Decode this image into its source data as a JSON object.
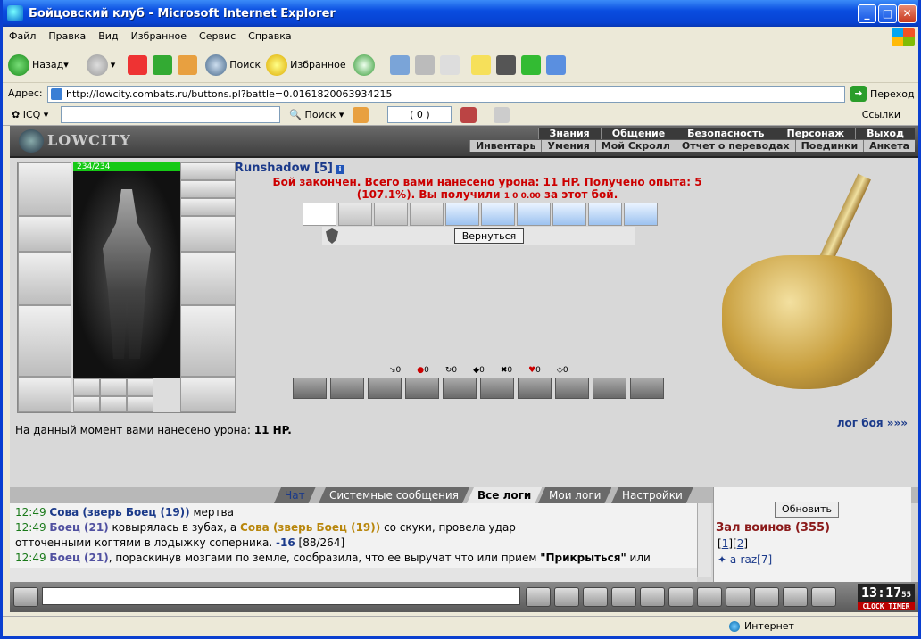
{
  "window": {
    "title": "Бойцовский клуб - Microsoft Internet Explorer"
  },
  "menu": [
    "Файл",
    "Правка",
    "Вид",
    "Избранное",
    "Сервис",
    "Справка"
  ],
  "toolbar": {
    "back": "Назад",
    "search": "Поиск",
    "favorites": "Избранное"
  },
  "address": {
    "label": "Адрес:",
    "url": "http://lowcity.combats.ru/buttons.pl?battle=0.0161820063934215",
    "go": "Переход"
  },
  "icqbar": {
    "icq": "ICQ",
    "search": "Поиск",
    "counter": "( 0 )",
    "links": "Ссылки"
  },
  "site": {
    "logo": "LOWCITY",
    "nav_top": [
      "Знания",
      "Общение",
      "Безопасность",
      "Персонаж",
      "Выход"
    ],
    "nav_bottom": [
      "Инвентарь",
      "Умения",
      "Мой Скролл",
      "Отчет о переводах",
      "Поединки",
      "Анкета"
    ]
  },
  "character": {
    "hp": "234/234",
    "nick": "Runshadow [5]"
  },
  "battle": {
    "result_line1": "Бой закончен. Всего вами нанесено урона: 11 HP. Получено опыта: 5",
    "result_line2": "(107.1%). Вы получили",
    "result_reward": "1  0  0.00",
    "result_tail": "за этот бой.",
    "back_button": "Вернуться",
    "stats": [
      "0",
      "0",
      "0",
      "0",
      "0",
      "0",
      "0"
    ],
    "damage_now": "На данный момент вами нанесено урона:",
    "damage_value": "11 HP.",
    "log_link": "лог боя »»»"
  },
  "chat": {
    "tabs": [
      "Чат",
      "Системные сообщения",
      "Все логи",
      "Мои логи",
      "Настройки"
    ],
    "active_tab": "Все логи",
    "lines": [
      {
        "time": "12:49",
        "name": "Сова (зверь Боец (19))",
        "text": " мертва"
      },
      {
        "time": "12:49",
        "name": "Боец (21)",
        "text": " ковырялась в зубах, а ",
        "name2": "Сова (зверь Боец (19))",
        "text2": " со скуки, провела удар"
      },
      {
        "cont": "отточенными когтями в лодыжку соперника. ",
        "dmg": "-16",
        "hp": " [88/264]"
      },
      {
        "time": "12:49",
        "name": "Боец (21)",
        "text": ", пораскинув мозгами по земле, сообразила, что ее выручат что или прием ",
        "strong": "\"Прикрыться\"",
        "tail": " или"
      }
    ]
  },
  "sidebar": {
    "refresh": "Обновить",
    "hall": "Зал воинов (355)",
    "page1": "1",
    "page2": "2",
    "online_user": "a-raz",
    "online_level": "[7]"
  },
  "clock": {
    "time": "13:17",
    "sec": "55",
    "label1": "CLOCK",
    "label2": "TIMER"
  },
  "status": {
    "zone": "Интернет"
  }
}
